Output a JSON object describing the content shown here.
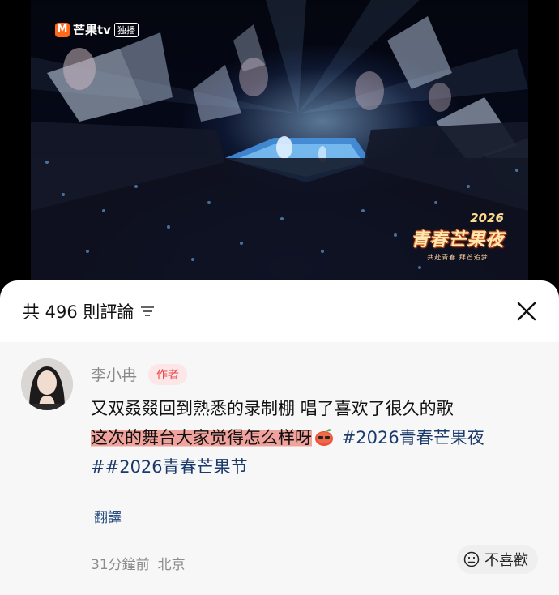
{
  "video": {
    "channel_logo_text": "芒果tv",
    "channel_badge": "独播",
    "event_year": "2026",
    "event_title": "青春芒果夜",
    "event_subtitle": "共赴青春  拜芒追梦",
    "accent_color": "#ff6a1a"
  },
  "comments_panel": {
    "header_title": "共 496 則評論",
    "sort_icon": "sort-lines-icon",
    "close_icon": "close-icon",
    "comment": {
      "author_name": "李小冉",
      "author_tag": "作者",
      "text_line1": "又双叒叕回到熟悉的录制棚 唱了喜欢了很久的歌",
      "text_highlight": "这次的舞台大家觉得怎么样呀",
      "emoji": "mango-emoji",
      "hashtag_1": "#2026青春芒果夜#",
      "hashtag_2": "#2026青春芒果节",
      "translate_label": "翻譯",
      "time": "31分鐘前",
      "location": "北京",
      "dislike_label": "不喜歡",
      "dislike_icon": "frown-face-icon"
    }
  }
}
